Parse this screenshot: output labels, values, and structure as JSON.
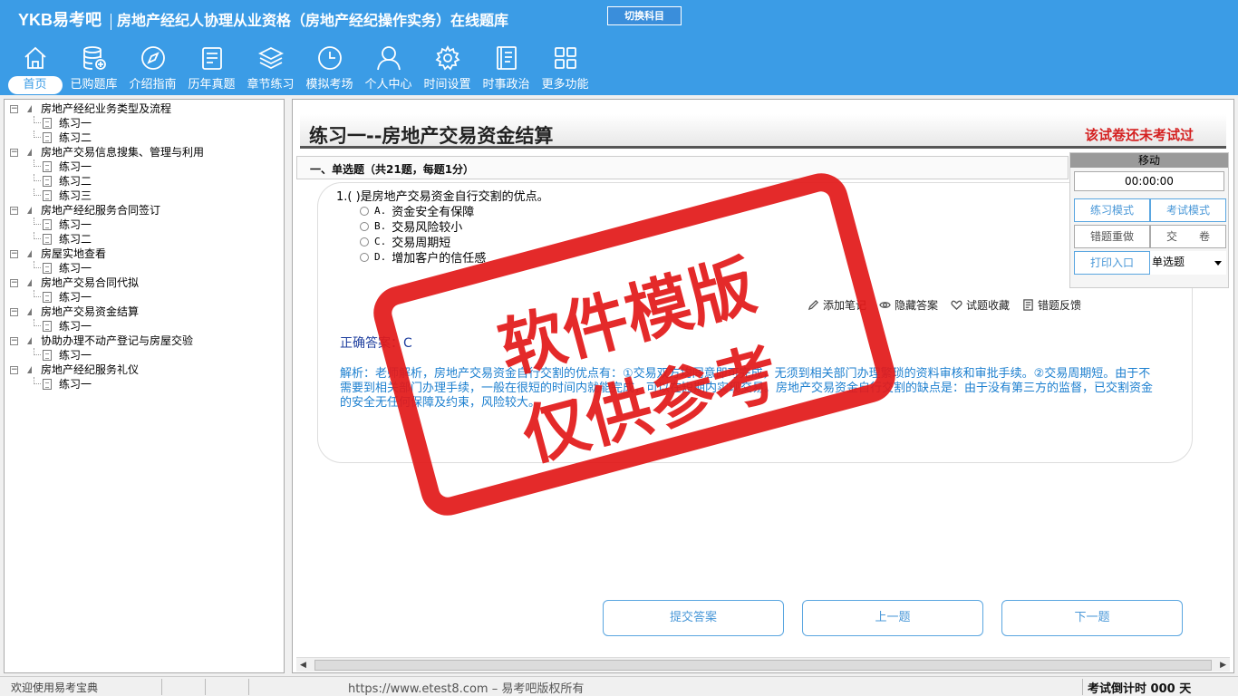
{
  "header": {
    "logo": "YKB易考吧",
    "title": "房地产经纪人协理从业资格（房地产经纪操作实务）在线题库",
    "switch_label": "切换科目"
  },
  "nav": [
    {
      "label": "首页",
      "icon": "home-icon"
    },
    {
      "label": "已购题库",
      "icon": "database-icon"
    },
    {
      "label": "介绍指南",
      "icon": "compass-icon"
    },
    {
      "label": "历年真题",
      "icon": "list-icon"
    },
    {
      "label": "章节练习",
      "icon": "layers-icon"
    },
    {
      "label": "模拟考场",
      "icon": "clock-icon"
    },
    {
      "label": "个人中心",
      "icon": "user-icon"
    },
    {
      "label": "时间设置",
      "icon": "gear-icon"
    },
    {
      "label": "时事政治",
      "icon": "book-icon"
    },
    {
      "label": "更多功能",
      "icon": "grid-icon"
    }
  ],
  "tree": [
    {
      "label": "房地产经纪业务类型及流程",
      "children": [
        "练习一",
        "练习二"
      ]
    },
    {
      "label": "房地产交易信息搜集、管理与利用",
      "children": [
        "练习一",
        "练习二",
        "练习三"
      ]
    },
    {
      "label": "房地产经纪服务合同签订",
      "children": [
        "练习一",
        "练习二"
      ]
    },
    {
      "label": "房屋实地查看",
      "children": [
        "练习一"
      ]
    },
    {
      "label": "房地产交易合同代拟",
      "children": [
        "练习一"
      ]
    },
    {
      "label": "房地产交易资金结算",
      "children": [
        "练习一"
      ]
    },
    {
      "label": "协助办理不动产登记与房屋交验",
      "children": [
        "练习一"
      ]
    },
    {
      "label": "房地产经纪服务礼仪",
      "children": [
        "练习一"
      ]
    }
  ],
  "exam": {
    "title": "练习一--房地产交易资金结算",
    "status": "该试卷还未考试过",
    "section": "一、单选题（共21题，每题1分）"
  },
  "question": {
    "stem": "1.(  )是房地产交易资金自行交割的优点。",
    "options": [
      {
        "key": "A.",
        "text": "资金安全有保障"
      },
      {
        "key": "B.",
        "text": "交易风险较小"
      },
      {
        "key": "C.",
        "text": "交易周期短"
      },
      {
        "key": "D.",
        "text": "增加客户的信任感"
      }
    ],
    "tools": [
      "添加笔记",
      "隐藏答案",
      "试题收藏",
      "错题反馈"
    ],
    "answer": "正确答案：C",
    "analysis": "解析：老师解析，房地产交易资金自行交割的优点有：①交易双方均同意即可完成，无须到相关部门办理繁琐的资料审核和审批手续。②交易周期短。由于不需要到相关部门办理手续，一般在很短的时间内就能完成，可以在短期内实现交易。房地产交易资金自行交割的缺点是：由于没有第三方的监督，已交割资金的安全无任何保障及约束，风险较大。"
  },
  "panel": {
    "header": "移动",
    "time": "00:00:00",
    "buttons": {
      "practice": "练习模式",
      "exam": "考试模式",
      "redo": "错题重做",
      "submit": "交　　卷",
      "print": "打印入口"
    },
    "select_value": "单选题"
  },
  "footer_buttons": {
    "submit": "提交答案",
    "prev": "上一题",
    "next": "下一题"
  },
  "statusbar": {
    "welcome": "欢迎使用易考宝典",
    "copyright": "https://www.etest8.com – 易考吧版权所有",
    "countdown": "考试倒计时 000 天"
  },
  "watermark": {
    "line1": "软件模版",
    "line2": "仅供参考"
  }
}
